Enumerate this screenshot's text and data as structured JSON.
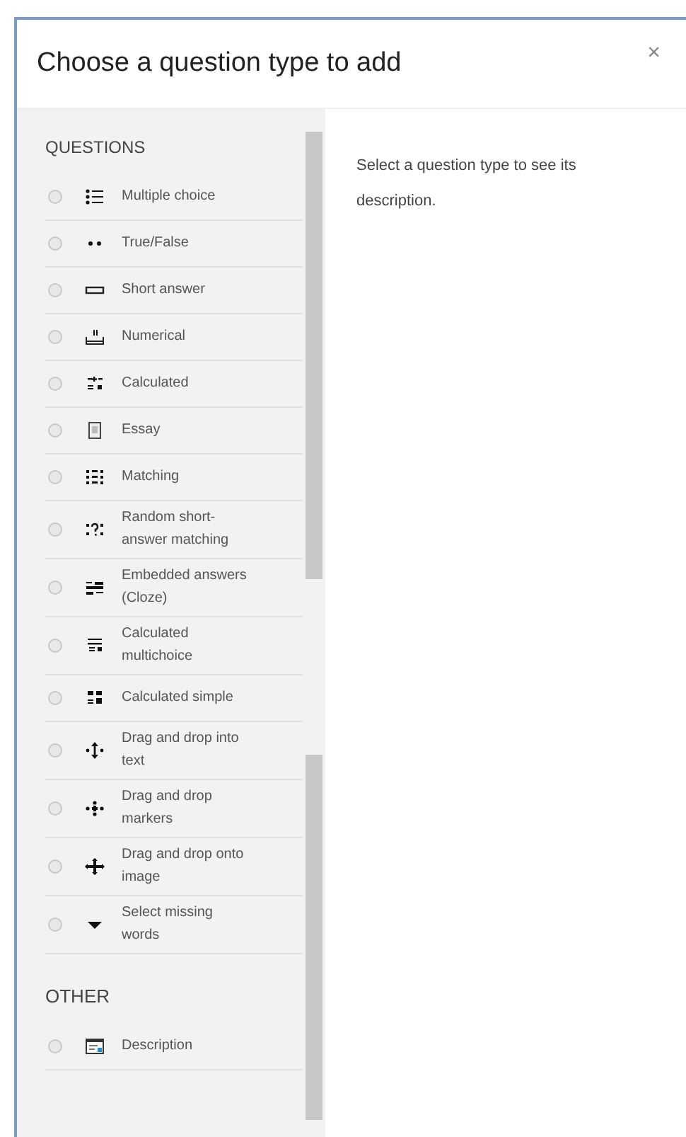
{
  "dialog": {
    "title": "Choose a question type to add",
    "close": "×"
  },
  "sections": [
    {
      "heading": "QUESTIONS",
      "items": [
        {
          "label": "Multiple choice",
          "selected": false
        },
        {
          "label": "True/False",
          "selected": false
        },
        {
          "label": "Short answer",
          "selected": false
        },
        {
          "label": "Numerical",
          "selected": false
        },
        {
          "label": "Calculated",
          "selected": false
        },
        {
          "label": "Essay",
          "selected": false
        },
        {
          "label": "Matching",
          "selected": false
        },
        {
          "label": "Random short-answer matching",
          "selected": false
        },
        {
          "label": "Embedded answers (Cloze)",
          "selected": false
        },
        {
          "label": "Calculated multichoice",
          "selected": false
        },
        {
          "label": "Calculated simple",
          "selected": false
        },
        {
          "label": "Drag and drop into text",
          "selected": false
        },
        {
          "label": "Drag and drop markers",
          "selected": false
        },
        {
          "label": "Drag and drop onto image",
          "selected": false
        },
        {
          "label": "Select missing words",
          "selected": false
        }
      ]
    },
    {
      "heading": "OTHER",
      "items": [
        {
          "label": "Description",
          "selected": false
        }
      ]
    }
  ],
  "description": "Select a question type to see its description."
}
